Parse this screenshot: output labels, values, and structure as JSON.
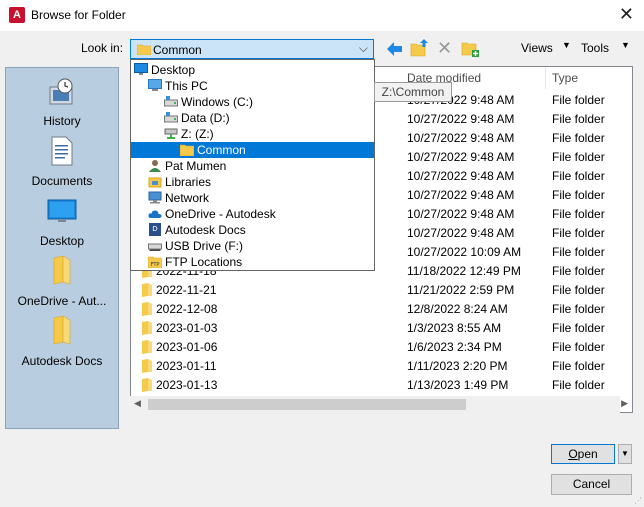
{
  "window": {
    "title": "Browse for Folder",
    "app_icon": "A",
    "close": "✕"
  },
  "toolbar": {
    "look_in_label": "Look in:",
    "look_in_value": "Common",
    "views_label": "Views",
    "tools_label": "Tools"
  },
  "places": [
    {
      "label": "History",
      "icon": "history-icon"
    },
    {
      "label": "Documents",
      "icon": "documents-icon"
    },
    {
      "label": "Desktop",
      "icon": "desktop-icon"
    },
    {
      "label": "OneDrive - Aut...",
      "icon": "folder-icon"
    },
    {
      "label": "Autodesk Docs",
      "icon": "folder-icon"
    }
  ],
  "file_list": {
    "headers": {
      "date": "Date modified",
      "type": "Type"
    },
    "rows": [
      {
        "name": "",
        "date": "10/27/2022 9:48 AM",
        "type": "File folder"
      },
      {
        "name": "",
        "date": "10/27/2022 9:48 AM",
        "type": "File folder"
      },
      {
        "name": "",
        "date": "10/27/2022 9:48 AM",
        "type": "File folder"
      },
      {
        "name": "",
        "date": "10/27/2022 9:48 AM",
        "type": "File folder"
      },
      {
        "name": "",
        "date": "10/27/2022 9:48 AM",
        "type": "File folder"
      },
      {
        "name": "",
        "date": "10/27/2022 9:48 AM",
        "type": "File folder"
      },
      {
        "name": "",
        "date": "10/27/2022 9:48 AM",
        "type": "File folder"
      },
      {
        "name": "",
        "date": "10/27/2022 9:48 AM",
        "type": "File folder"
      },
      {
        "name": "",
        "date": "10/27/2022 10:09 AM",
        "type": "File folder"
      },
      {
        "name": "2022-11-18",
        "date": "11/18/2022 12:49 PM",
        "type": "File folder"
      },
      {
        "name": "2022-11-21",
        "date": "11/21/2022 2:59 PM",
        "type": "File folder"
      },
      {
        "name": "2022-12-08",
        "date": "12/8/2022 8:24 AM",
        "type": "File folder"
      },
      {
        "name": "2023-01-03",
        "date": "1/3/2023 8:55 AM",
        "type": "File folder"
      },
      {
        "name": "2023-01-06",
        "date": "1/6/2023 2:34 PM",
        "type": "File folder"
      },
      {
        "name": "2023-01-11",
        "date": "1/11/2023 2:20 PM",
        "type": "File folder"
      },
      {
        "name": "2023-01-13",
        "date": "1/13/2023 1:49 PM",
        "type": "File folder"
      }
    ]
  },
  "dropdown": {
    "items": [
      {
        "label": "Desktop",
        "icon": "desktop-icon"
      },
      {
        "label": "This PC",
        "icon": "pc-icon"
      },
      {
        "label": "Windows (C:)",
        "icon": "drive-icon"
      },
      {
        "label": "Data (D:)",
        "icon": "drive-icon"
      },
      {
        "label": "Z: (Z:)",
        "icon": "network-drive-icon"
      },
      {
        "label": "Common",
        "icon": "folder-icon"
      },
      {
        "label": "Pat Mumen",
        "icon": "user-icon"
      },
      {
        "label": "Libraries",
        "icon": "libraries-icon"
      },
      {
        "label": "Network",
        "icon": "network-icon"
      },
      {
        "label": "OneDrive - Autodesk",
        "icon": "cloud-icon"
      },
      {
        "label": "Autodesk Docs",
        "icon": "autodesk-docs-icon"
      },
      {
        "label": "USB Drive (F:)",
        "icon": "usb-icon"
      },
      {
        "label": "FTP Locations",
        "icon": "ftp-icon"
      }
    ]
  },
  "tooltip": "Z:\\Common",
  "buttons": {
    "open_first": "O",
    "open_rest": "pen",
    "cancel": "Cancel"
  },
  "colors": {
    "accent": "#0078d7",
    "places_bg": "#b9cde0",
    "folder": "#f5c94a"
  }
}
